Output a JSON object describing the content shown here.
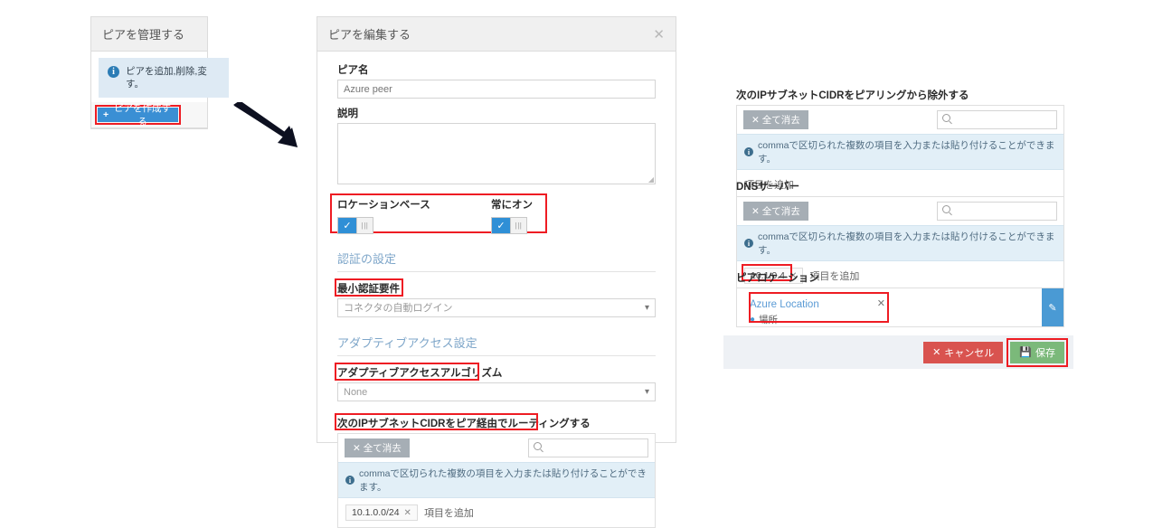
{
  "manage_panel": {
    "title": "ピアを管理する",
    "alert_text": "ピアを追加,削除,変\nす。",
    "create_button": "ピアを作成する",
    "plus_icon": "plus-icon",
    "info_icon": "info-icon"
  },
  "edit_panel": {
    "title": "ピアを編集する",
    "close_icon": "close-icon",
    "peer_name": {
      "label": "ピア名",
      "value": "",
      "placeholder": "Azure peer"
    },
    "description": {
      "label": "説明",
      "value": "",
      "placeholder": ""
    },
    "toggles": [
      {
        "label": "ロケーションベース",
        "state": "on",
        "check_icon": "check-icon"
      },
      {
        "label": "常にオン",
        "state": "on",
        "check_icon": "check-icon"
      }
    ],
    "auth_section": {
      "title": "認証の設定",
      "min_auth_label": "最小認証要件",
      "min_auth_value": "コネクタの自動ログイン"
    },
    "adaptive_section": {
      "title": "アダプティブアクセス設定",
      "algorithm_label": "アダプティブアクセスアルゴリズム",
      "algorithm_value": "None"
    },
    "route_subnets": {
      "label": "次のIPサブネットCIDRをピア経由でルーティングする",
      "clear_button": "全て消去",
      "search_placeholder": "",
      "info": "commaで区切られた複数の項目を入力または貼り付けることができます。",
      "chips": [
        "10.1.0.0/24"
      ],
      "add_placeholder": "項目を追加"
    }
  },
  "right_panel": {
    "exclude_subnets": {
      "label": "次のIPサブネットCIDRをピアリングから除外する",
      "clear_button": "全て消去",
      "search_placeholder": "",
      "info": "commaで区切られた複数の項目を入力または貼り付けることができます。",
      "chips": [],
      "add_placeholder": "項目を追加"
    },
    "dns_servers": {
      "label": "DNSサーバー",
      "clear_button": "全て消去",
      "search_placeholder": "",
      "info": "commaで区切られた複数の項目を入力または貼り付けることができます。",
      "chips": [
        "10.1.0.4"
      ],
      "add_placeholder": "項目を追加"
    },
    "peer_location": {
      "label": "ピアロケーション",
      "card_title": "Azure Location",
      "card_subtitle": "場所",
      "pin_icon": "map-pin-icon",
      "remove_icon": "close-icon",
      "edit_icon": "pencil-icon"
    },
    "footer": {
      "cancel_label": "キャンセル",
      "save_label": "保存",
      "cancel_icon": "x-icon",
      "save_icon": "save-disk-icon"
    }
  },
  "annotation": {
    "arrow_icon": "arrow-down-right-icon",
    "highlight_color": "#ee1c23"
  },
  "clear_icon": "x-icon",
  "search_icon": "search-icon",
  "chip_remove_icon": "x-icon"
}
